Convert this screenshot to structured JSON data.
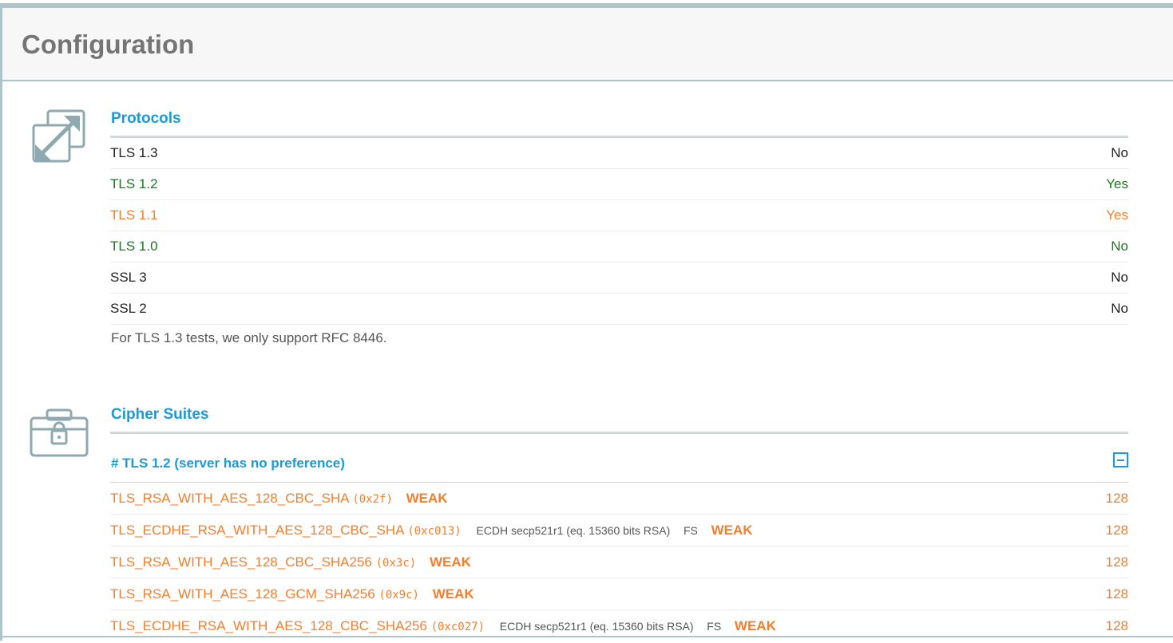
{
  "page": {
    "title": "Configuration"
  },
  "colors": {
    "accent": "#1a9ad6",
    "ok_green": "#187a1e",
    "warn_orange": "#f37f2d",
    "frame": "#adc4c9"
  },
  "protocols": {
    "icon": "expand-arrows-icon",
    "title": "Protocols",
    "rows": [
      {
        "name": "TLS 1.3",
        "value": "No"
      },
      {
        "name": "TLS 1.2",
        "value": "Yes"
      },
      {
        "name": "TLS 1.1",
        "value": "Yes"
      },
      {
        "name": "TLS 1.0",
        "value": "No"
      },
      {
        "name": "SSL 3",
        "value": "No"
      },
      {
        "name": "SSL 2",
        "value": "No"
      }
    ],
    "note": "For TLS 1.3 tests, we only support RFC 8446."
  },
  "cipher_suites": {
    "icon": "locked-toolbox-icon",
    "title": "Cipher Suites",
    "group_heading": "# TLS 1.2 (server has no preference)",
    "collapse_icon": "minus-square-icon",
    "suites": [
      {
        "name": "TLS_RSA_WITH_AES_128_CBC_SHA",
        "code": "(0x2f)",
        "extra": "",
        "fs": "",
        "flag": "WEAK",
        "bits": "128"
      },
      {
        "name": "TLS_ECDHE_RSA_WITH_AES_128_CBC_SHA",
        "code": "(0xc013)",
        "extra": "ECDH secp521r1 (eq. 15360 bits RSA)",
        "fs": "FS",
        "flag": "WEAK",
        "bits": "128"
      },
      {
        "name": "TLS_RSA_WITH_AES_128_CBC_SHA256",
        "code": "(0x3c)",
        "extra": "",
        "fs": "",
        "flag": "WEAK",
        "bits": "128"
      },
      {
        "name": "TLS_RSA_WITH_AES_128_GCM_SHA256",
        "code": "(0x9c)",
        "extra": "",
        "fs": "",
        "flag": "WEAK",
        "bits": "128"
      },
      {
        "name": "TLS_ECDHE_RSA_WITH_AES_128_CBC_SHA256",
        "code": "(0xc027)",
        "extra": "ECDH secp521r1 (eq. 15360 bits RSA)",
        "fs": "FS",
        "flag": "WEAK",
        "bits": "128"
      }
    ]
  }
}
